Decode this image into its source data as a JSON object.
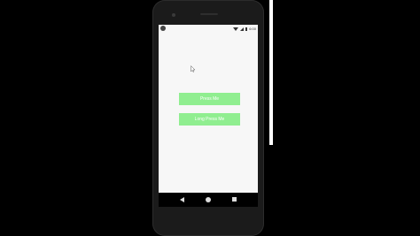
{
  "app": {
    "buttons": {
      "press_label": "Press Me",
      "long_press_label": "Long Press Me"
    },
    "button_color": "#90ee90"
  },
  "status_bar": {
    "time": "6:00"
  },
  "icons": {
    "notification": "app-notification-icon",
    "wifi": "wifi-icon",
    "signal": "signal-icon",
    "battery": "battery-icon",
    "cursor": "mouse-cursor-icon",
    "nav_back": "back-triangle-icon",
    "nav_home": "home-circle-icon",
    "nav_recents": "recents-square-icon"
  }
}
